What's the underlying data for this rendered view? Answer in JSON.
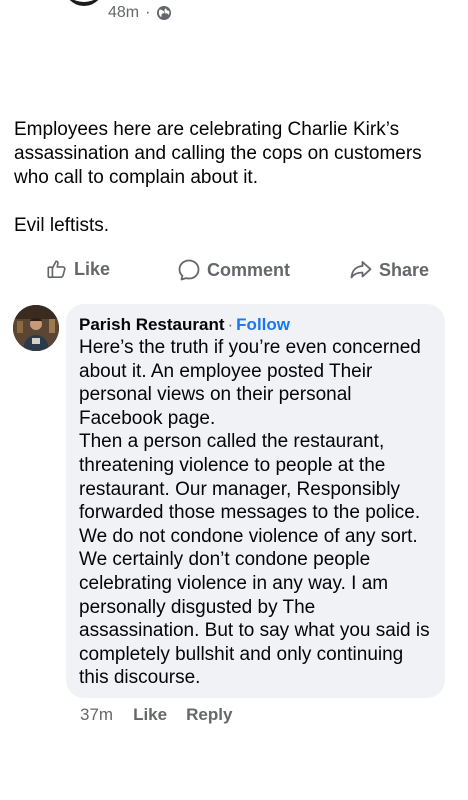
{
  "post": {
    "time": "48m",
    "separator": "·",
    "privacy_icon": "globe-icon",
    "text_paragraph_1": "Employees here are celebrating Charlie Kirk’s assassination and calling the cops on customers who call to complain about it.",
    "text_paragraph_2": "Evil leftists."
  },
  "actions": {
    "like": {
      "label": "Like",
      "icon": "thumbs-up-icon"
    },
    "comment": {
      "label": "Comment",
      "icon": "comment-bubble-icon"
    },
    "share": {
      "label": "Share",
      "icon": "share-arrow-icon"
    }
  },
  "comment": {
    "author": "Parish Restaurant",
    "separator": "·",
    "follow_label": "Follow",
    "text_paragraph_1": "Here’s the truth if you’re even concerned about it. An employee posted Their personal views on their personal Facebook page.",
    "text_paragraph_2": "Then a person called the restaurant, threatening violence to people at the restaurant. Our manager, Responsibly forwarded those messages to the police. We do not condone violence of any sort. We certainly don’t condone people celebrating violence in any way. I am personally disgusted by The assassination. But to say what you said is completely bullshit and only continuing this discourse.",
    "time": "37m",
    "like_label": "Like",
    "reply_label": "Reply"
  },
  "colors": {
    "link_blue": "#1877f2",
    "muted_gray": "#65676b",
    "bubble_bg": "#f0f2f5"
  }
}
